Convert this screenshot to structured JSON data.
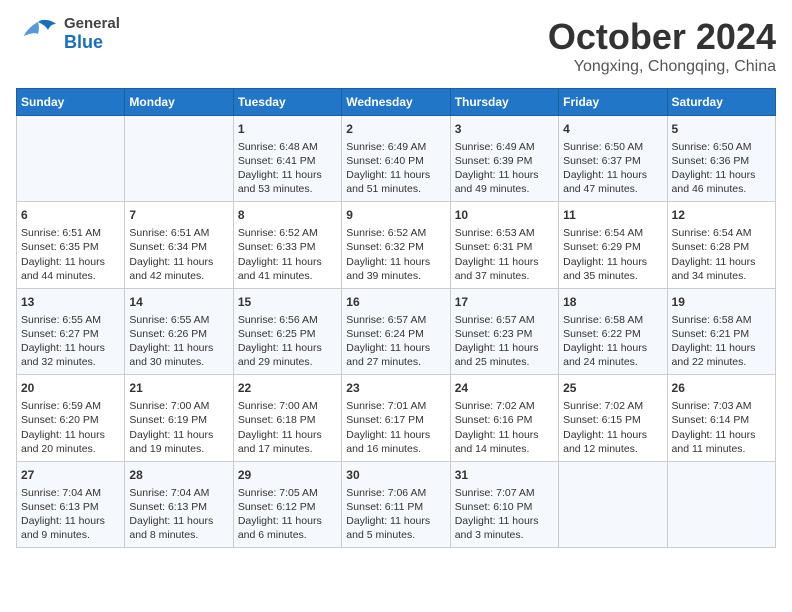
{
  "header": {
    "logo_general": "General",
    "logo_blue": "Blue",
    "month": "October 2024",
    "location": "Yongxing, Chongqing, China"
  },
  "days_of_week": [
    "Sunday",
    "Monday",
    "Tuesday",
    "Wednesday",
    "Thursday",
    "Friday",
    "Saturday"
  ],
  "weeks": [
    [
      {
        "day": "",
        "info": ""
      },
      {
        "day": "",
        "info": ""
      },
      {
        "day": "1",
        "info": "Sunrise: 6:48 AM\nSunset: 6:41 PM\nDaylight: 11 hours\nand 53 minutes."
      },
      {
        "day": "2",
        "info": "Sunrise: 6:49 AM\nSunset: 6:40 PM\nDaylight: 11 hours\nand 51 minutes."
      },
      {
        "day": "3",
        "info": "Sunrise: 6:49 AM\nSunset: 6:39 PM\nDaylight: 11 hours\nand 49 minutes."
      },
      {
        "day": "4",
        "info": "Sunrise: 6:50 AM\nSunset: 6:37 PM\nDaylight: 11 hours\nand 47 minutes."
      },
      {
        "day": "5",
        "info": "Sunrise: 6:50 AM\nSunset: 6:36 PM\nDaylight: 11 hours\nand 46 minutes."
      }
    ],
    [
      {
        "day": "6",
        "info": "Sunrise: 6:51 AM\nSunset: 6:35 PM\nDaylight: 11 hours\nand 44 minutes."
      },
      {
        "day": "7",
        "info": "Sunrise: 6:51 AM\nSunset: 6:34 PM\nDaylight: 11 hours\nand 42 minutes."
      },
      {
        "day": "8",
        "info": "Sunrise: 6:52 AM\nSunset: 6:33 PM\nDaylight: 11 hours\nand 41 minutes."
      },
      {
        "day": "9",
        "info": "Sunrise: 6:52 AM\nSunset: 6:32 PM\nDaylight: 11 hours\nand 39 minutes."
      },
      {
        "day": "10",
        "info": "Sunrise: 6:53 AM\nSunset: 6:31 PM\nDaylight: 11 hours\nand 37 minutes."
      },
      {
        "day": "11",
        "info": "Sunrise: 6:54 AM\nSunset: 6:29 PM\nDaylight: 11 hours\nand 35 minutes."
      },
      {
        "day": "12",
        "info": "Sunrise: 6:54 AM\nSunset: 6:28 PM\nDaylight: 11 hours\nand 34 minutes."
      }
    ],
    [
      {
        "day": "13",
        "info": "Sunrise: 6:55 AM\nSunset: 6:27 PM\nDaylight: 11 hours\nand 32 minutes."
      },
      {
        "day": "14",
        "info": "Sunrise: 6:55 AM\nSunset: 6:26 PM\nDaylight: 11 hours\nand 30 minutes."
      },
      {
        "day": "15",
        "info": "Sunrise: 6:56 AM\nSunset: 6:25 PM\nDaylight: 11 hours\nand 29 minutes."
      },
      {
        "day": "16",
        "info": "Sunrise: 6:57 AM\nSunset: 6:24 PM\nDaylight: 11 hours\nand 27 minutes."
      },
      {
        "day": "17",
        "info": "Sunrise: 6:57 AM\nSunset: 6:23 PM\nDaylight: 11 hours\nand 25 minutes."
      },
      {
        "day": "18",
        "info": "Sunrise: 6:58 AM\nSunset: 6:22 PM\nDaylight: 11 hours\nand 24 minutes."
      },
      {
        "day": "19",
        "info": "Sunrise: 6:58 AM\nSunset: 6:21 PM\nDaylight: 11 hours\nand 22 minutes."
      }
    ],
    [
      {
        "day": "20",
        "info": "Sunrise: 6:59 AM\nSunset: 6:20 PM\nDaylight: 11 hours\nand 20 minutes."
      },
      {
        "day": "21",
        "info": "Sunrise: 7:00 AM\nSunset: 6:19 PM\nDaylight: 11 hours\nand 19 minutes."
      },
      {
        "day": "22",
        "info": "Sunrise: 7:00 AM\nSunset: 6:18 PM\nDaylight: 11 hours\nand 17 minutes."
      },
      {
        "day": "23",
        "info": "Sunrise: 7:01 AM\nSunset: 6:17 PM\nDaylight: 11 hours\nand 16 minutes."
      },
      {
        "day": "24",
        "info": "Sunrise: 7:02 AM\nSunset: 6:16 PM\nDaylight: 11 hours\nand 14 minutes."
      },
      {
        "day": "25",
        "info": "Sunrise: 7:02 AM\nSunset: 6:15 PM\nDaylight: 11 hours\nand 12 minutes."
      },
      {
        "day": "26",
        "info": "Sunrise: 7:03 AM\nSunset: 6:14 PM\nDaylight: 11 hours\nand 11 minutes."
      }
    ],
    [
      {
        "day": "27",
        "info": "Sunrise: 7:04 AM\nSunset: 6:13 PM\nDaylight: 11 hours\nand 9 minutes."
      },
      {
        "day": "28",
        "info": "Sunrise: 7:04 AM\nSunset: 6:13 PM\nDaylight: 11 hours\nand 8 minutes."
      },
      {
        "day": "29",
        "info": "Sunrise: 7:05 AM\nSunset: 6:12 PM\nDaylight: 11 hours\nand 6 minutes."
      },
      {
        "day": "30",
        "info": "Sunrise: 7:06 AM\nSunset: 6:11 PM\nDaylight: 11 hours\nand 5 minutes."
      },
      {
        "day": "31",
        "info": "Sunrise: 7:07 AM\nSunset: 6:10 PM\nDaylight: 11 hours\nand 3 minutes."
      },
      {
        "day": "",
        "info": ""
      },
      {
        "day": "",
        "info": ""
      }
    ]
  ]
}
